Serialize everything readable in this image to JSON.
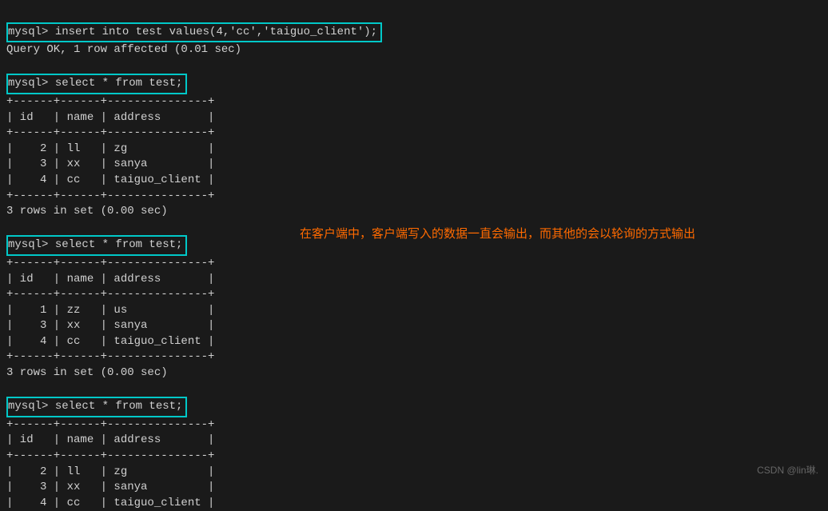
{
  "terminal": {
    "line1_prompt": "mysql> ",
    "line1_cmd": "insert into test values(4,'cc','taiguo_client');",
    "line2": "Query OK, 1 row affected (0.01 sec)",
    "blank": "",
    "select_prompt": "mysql> ",
    "select_cmd": "select * from test;",
    "sep": "+------+------+---------------+",
    "header": "| id   | name | address       |",
    "result1": {
      "rows": [
        "|    2 | ll   | zg            |",
        "|    3 | xx   | sanya         |",
        "|    4 | cc   | taiguo_client |"
      ],
      "footer": "3 rows in set (0.00 sec)"
    },
    "result2": {
      "rows": [
        "|    1 | zz   | us            |",
        "|    3 | xx   | sanya         |",
        "|    4 | cc   | taiguo_client |"
      ],
      "footer": "3 rows in set (0.00 sec)"
    },
    "result3": {
      "rows": [
        "|    2 | ll   | zg            |",
        "|    3 | xx   | sanya         |",
        "|    4 | cc   | taiguo_client |"
      ]
    }
  },
  "annotation": {
    "text": "在客户端中，客户端写入的数据一直会输出，而其他的会以轮询的方式输出"
  },
  "watermark": {
    "text": "CSDN @lin琳."
  }
}
